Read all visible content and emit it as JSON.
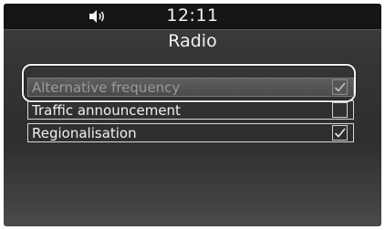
{
  "status": {
    "time": "12:11",
    "volume_icon": "speaker-volume-icon"
  },
  "screen": {
    "title": "Radio"
  },
  "options": [
    {
      "label": "Alternative frequency",
      "checked": true,
      "selected": true
    },
    {
      "label": "Traffic announcement",
      "checked": false,
      "selected": false
    },
    {
      "label": "Regionalisation",
      "checked": true,
      "selected": false
    }
  ],
  "colors": {
    "status_bar": "#151515",
    "background": "#353535",
    "text": "#f2f2f2",
    "highlight": "#5f5f5f"
  }
}
